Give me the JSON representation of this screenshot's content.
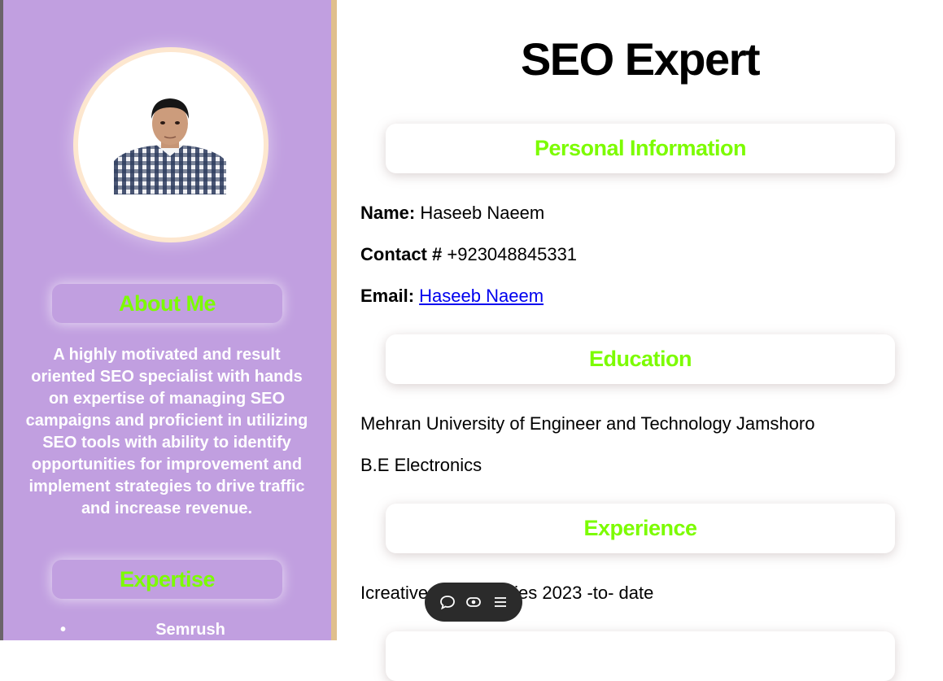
{
  "sidebar": {
    "about_title": "About Me",
    "about_text": "A highly motivated and result oriented SEO specialist with hands on expertise of managing SEO campaigns and proficient in utilizing SEO tools with ability to identify opportunities for improvement and implement strategies to drive traffic and increase revenue.",
    "expertise_title": "Expertise",
    "expertise_items": [
      "Semrush"
    ]
  },
  "main": {
    "title": "SEO Expert",
    "personal_title": "Personal Information",
    "name_label": "Name:",
    "name_value": "Haseeb Naeem",
    "contact_label": "Contact #",
    "contact_value": "+923048845331",
    "email_label": "Email:",
    "email_link": "Haseeb Naeem",
    "education_title": "Education",
    "education_school": "Mehran University of Engineer and Technology Jamshoro",
    "education_degree": "B.E Electronics",
    "experience_title": "Experience",
    "experience_text": "Icreative Technologies 2023 -to- date"
  },
  "toolbar": {
    "icons": [
      "chat-icon",
      "eye-icon",
      "menu-icon"
    ]
  },
  "colors": {
    "sidebar_bg": "#c19fe0",
    "heading_green": "#7cfc00",
    "sidebar_border": "#e0bf8d",
    "link_blue": "#0000ee"
  }
}
